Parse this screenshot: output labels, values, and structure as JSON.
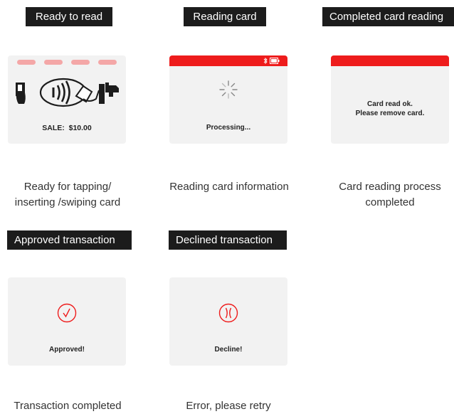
{
  "steps": [
    {
      "label": "Ready to read",
      "screen_text": "SALE:  $10.00",
      "caption_line1": "Ready for tapping/",
      "caption_line2": "inserting /swiping card"
    },
    {
      "label": "Reading card",
      "screen_text": "Processing...",
      "caption_line1": "Reading card information",
      "caption_line2": ""
    },
    {
      "label": "Completed card reading",
      "screen_text_line1": "Card read ok.",
      "screen_text_line2": "Please remove card.",
      "caption_line1": "Card reading process",
      "caption_line2": "completed"
    },
    {
      "label": "Approved transaction",
      "screen_text": "Approved!",
      "caption_line1": "Transaction completed",
      "caption_line2": ""
    },
    {
      "label": "Declined transaction",
      "screen_text": "Decline!",
      "caption_line1": "Error, please retry",
      "caption_line2": ""
    }
  ],
  "colors": {
    "accent_red": "#ee1c1c",
    "label_bg": "#1c1c1c",
    "screen_bg": "#f2f2f2",
    "dash_pink": "#f4a7a7"
  },
  "icons": {
    "status_bar": [
      "bluetooth-icon",
      "battery-icon"
    ],
    "ready_screen": [
      "card-insert-icon",
      "contactless-tap-icon",
      "card-swipe-icon"
    ],
    "reading_screen": [
      "loading-spinner-icon"
    ],
    "approved_screen": [
      "checkmark-circle-icon"
    ],
    "declined_screen": [
      "x-circle-icon"
    ]
  }
}
